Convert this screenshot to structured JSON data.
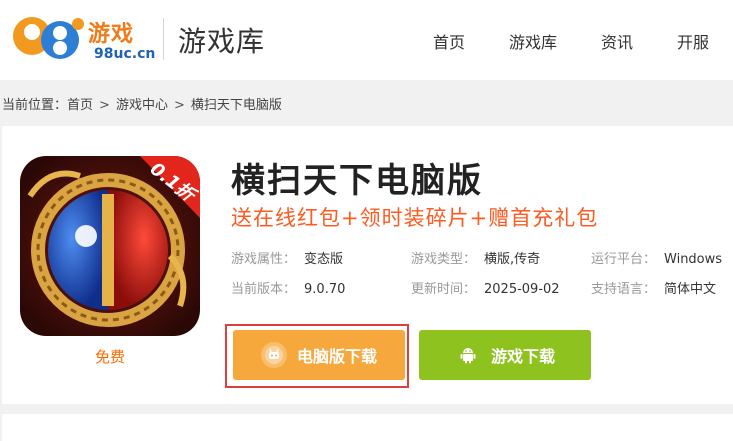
{
  "header": {
    "logo_text": "游戏",
    "logo_domain": "98uc.cn",
    "site_title": "游戏库",
    "nav": [
      "首页",
      "游戏库",
      "资讯",
      "开服"
    ]
  },
  "breadcrumb": {
    "prefix": "当前位置：",
    "items": [
      "首页",
      "游戏中心",
      "横扫天下电脑版"
    ],
    "separator": ">"
  },
  "game": {
    "title": "横扫天下电脑版",
    "promo": "送在线红包+领时装碎片+赠首充礼包",
    "free_label": "免费",
    "icon_badge": "0.1折",
    "info": [
      [
        {
          "label": "游戏属性：",
          "value": "变态版"
        },
        {
          "label": "游戏类型：",
          "value": "横版,传奇"
        },
        {
          "label": "运行平台：",
          "value": "Windows"
        }
      ],
      [
        {
          "label": "当前版本：",
          "value": "9.0.70"
        },
        {
          "label": "更新时间：",
          "value": "2025-09-02"
        },
        {
          "label": "支持语言：",
          "value": "简体中文"
        }
      ]
    ]
  },
  "buttons": {
    "pc_download": "电脑版下载",
    "game_download": "游戏下载"
  },
  "colors": {
    "accent_orange": "#f6a83d",
    "accent_green": "#8dc21f",
    "promo_red": "#ff5a1f",
    "focus_border": "#e03d3d"
  }
}
